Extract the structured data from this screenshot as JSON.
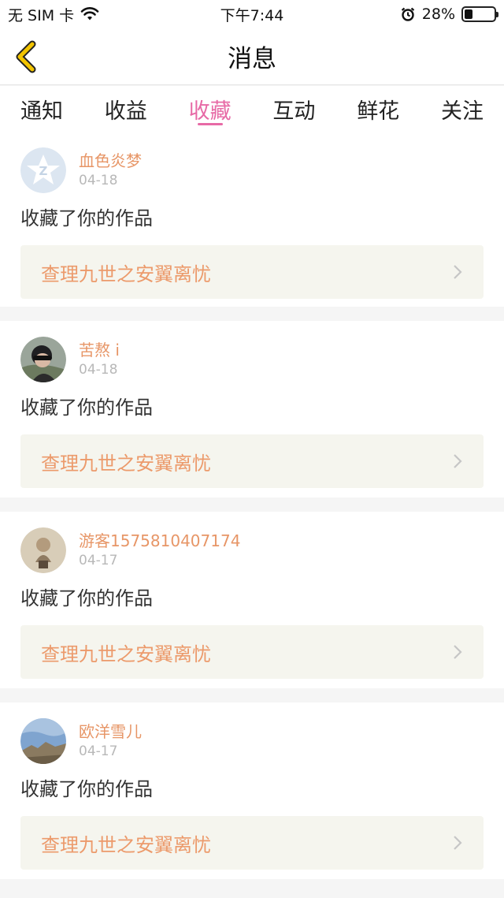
{
  "status_bar": {
    "carrier": "无 SIM 卡",
    "time": "下午7:44",
    "battery_text": "28%",
    "battery_level": 0.28,
    "icons": [
      "wifi-icon",
      "alarm-icon",
      "battery-icon"
    ]
  },
  "nav": {
    "title": "消息",
    "back_icon": "chevron-left-icon",
    "back_color": "#f2c400"
  },
  "tabs": [
    {
      "label": "通知",
      "active": false
    },
    {
      "label": "收益",
      "active": false
    },
    {
      "label": "收藏",
      "active": true
    },
    {
      "label": "互动",
      "active": false
    },
    {
      "label": "鲜花",
      "active": false
    },
    {
      "label": "关注",
      "active": false
    }
  ],
  "accent_color": "#e76aa6",
  "items": [
    {
      "user": "血色炎梦",
      "date": "04-18",
      "action": "收藏了你的作品",
      "work": "查理九世之安翼离忧",
      "avatar": "qq-default-avatar"
    },
    {
      "user": "苦熬 i",
      "date": "04-18",
      "action": "收藏了你的作品",
      "work": "查理九世之安翼离忧",
      "avatar": "photo-avatar"
    },
    {
      "user": "游客1575810407174",
      "date": "04-17",
      "action": "收藏了你的作品",
      "work": "查理九世之安翼离忧",
      "avatar": "photo-avatar"
    },
    {
      "user": "欧洋雪儿",
      "date": "04-17",
      "action": "收藏了你的作品",
      "work": "查理九世之安翼离忧",
      "avatar": "photo-avatar"
    }
  ]
}
